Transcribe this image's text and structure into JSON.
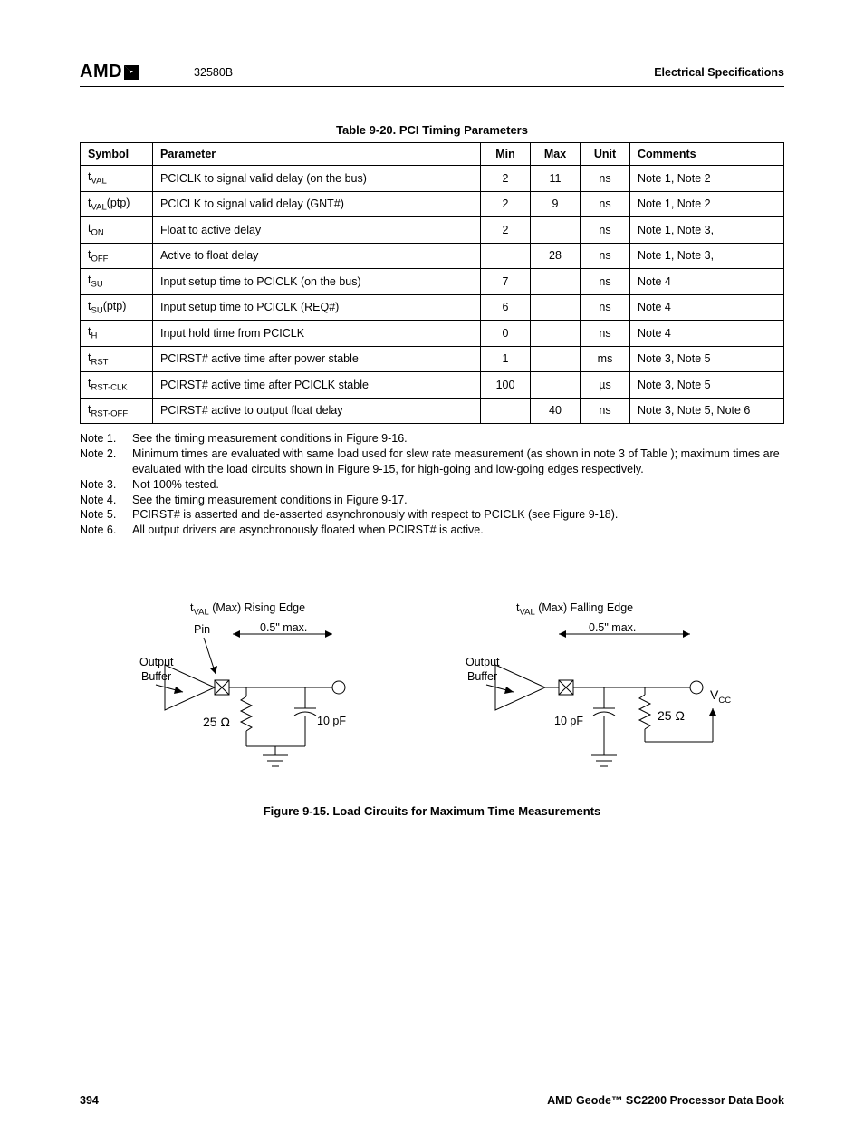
{
  "header": {
    "logo_text": "AMD",
    "doc_code": "32580B",
    "section": "Electrical Specifications"
  },
  "table": {
    "caption": "Table 9-20.  PCI Timing Parameters",
    "headers": [
      "Symbol",
      "Parameter",
      "Min",
      "Max",
      "Unit",
      "Comments"
    ],
    "rows": [
      {
        "sym_base": "t",
        "sym_sub": "VAL",
        "sym_suffix": "",
        "param": "PCICLK to signal valid delay (on the bus)",
        "min": "2",
        "max": "11",
        "unit": "ns",
        "comments": "Note 1, Note 2"
      },
      {
        "sym_base": "t",
        "sym_sub": "VAL",
        "sym_suffix": "(ptp)",
        "param": "PCICLK to signal valid delay (GNT#)",
        "min": "2",
        "max": "9",
        "unit": "ns",
        "comments": "Note 1, Note 2"
      },
      {
        "sym_base": "t",
        "sym_sub": "ON",
        "sym_suffix": "",
        "param": "Float to active delay",
        "min": "2",
        "max": "",
        "unit": "ns",
        "comments": "Note 1, Note 3,"
      },
      {
        "sym_base": "t",
        "sym_sub": "OFF",
        "sym_suffix": "",
        "param": "Active to float delay",
        "min": "",
        "max": "28",
        "unit": "ns",
        "comments": "Note 1, Note 3,"
      },
      {
        "sym_base": "t",
        "sym_sub": "SU",
        "sym_suffix": "",
        "param": "Input setup time to PCICLK (on the bus)",
        "min": "7",
        "max": "",
        "unit": "ns",
        "comments": "Note 4"
      },
      {
        "sym_base": "t",
        "sym_sub": "SU",
        "sym_suffix": "(ptp)",
        "param": "Input setup time to PCICLK (REQ#)",
        "min": "6",
        "max": "",
        "unit": "ns",
        "comments": "Note 4"
      },
      {
        "sym_base": "t",
        "sym_sub": "H",
        "sym_suffix": "",
        "param": "Input hold time from PCICLK",
        "min": "0",
        "max": "",
        "unit": "ns",
        "comments": "Note 4"
      },
      {
        "sym_base": "t",
        "sym_sub": "RST",
        "sym_suffix": "",
        "param": "PCIRST# active time after power stable",
        "min": "1",
        "max": "",
        "unit": "ms",
        "comments": "Note 3, Note 5"
      },
      {
        "sym_base": "t",
        "sym_sub": "RST-CLK",
        "sym_suffix": "",
        "param": "PCIRST# active time after PCICLK stable",
        "min": "100",
        "max": "",
        "unit": "µs",
        "comments": "Note 3, Note 5"
      },
      {
        "sym_base": "t",
        "sym_sub": "RST-OFF",
        "sym_suffix": "",
        "param": "PCIRST# active to output float delay",
        "min": "",
        "max": "40",
        "unit": "ns",
        "comments": "Note 3, Note 5, Note 6"
      }
    ]
  },
  "notes": [
    {
      "label": "Note 1.",
      "text": "See the timing measurement conditions in Figure 9-16."
    },
    {
      "label": "Note 2.",
      "text": "Minimum times are evaluated with same load used for slew rate measurement (as shown in note 3 of Table ); maximum times are evaluated with the load circuits shown in Figure 9-15, for high-going and low-going edges respectively."
    },
    {
      "label": "Note 3.",
      "text": "Not 100% tested."
    },
    {
      "label": "Note 4.",
      "text": "See the timing measurement conditions in Figure 9-17."
    },
    {
      "label": "Note 5.",
      "text": "PCIRST# is asserted and de-asserted asynchronously with respect to PCICLK (see Figure 9-18)."
    },
    {
      "label": "Note 6.",
      "text": "All output drivers are asynchronously floated when PCIRST# is active."
    }
  ],
  "figure": {
    "left": {
      "title_prefix": "t",
      "title_sub": "VAL",
      "title_suffix": " (Max) Rising Edge",
      "pin": "Pin",
      "dist": "0.5\" max.",
      "outbuf1": "Output",
      "outbuf2": "Buffer",
      "res": "25 Ω",
      "cap": "10 pF"
    },
    "right": {
      "title_prefix": "t",
      "title_sub": "VAL",
      "title_suffix": " (Max) Falling Edge",
      "dist": "0.5\" max.",
      "outbuf1": "Output",
      "outbuf2": "Buffer",
      "res": "25 Ω",
      "cap": "10 pF",
      "vcc": "V",
      "vcc_sub": "CC"
    },
    "caption": "Figure 9-15.  Load Circuits for Maximum Time Measurements"
  },
  "footer": {
    "page": "394",
    "book": "AMD Geode™ SC2200  Processor Data Book"
  },
  "chart_data": {
    "type": "table",
    "title": "Table 9-20. PCI Timing Parameters",
    "columns": [
      "Symbol",
      "Parameter",
      "Min",
      "Max",
      "Unit",
      "Comments"
    ],
    "rows": [
      [
        "t_VAL",
        "PCICLK to signal valid delay (on the bus)",
        2,
        11,
        "ns",
        "Note 1, Note 2"
      ],
      [
        "t_VAL(ptp)",
        "PCICLK to signal valid delay (GNT#)",
        2,
        9,
        "ns",
        "Note 1, Note 2"
      ],
      [
        "t_ON",
        "Float to active delay",
        2,
        null,
        "ns",
        "Note 1, Note 3"
      ],
      [
        "t_OFF",
        "Active to float delay",
        null,
        28,
        "ns",
        "Note 1, Note 3"
      ],
      [
        "t_SU",
        "Input setup time to PCICLK (on the bus)",
        7,
        null,
        "ns",
        "Note 4"
      ],
      [
        "t_SU(ptp)",
        "Input setup time to PCICLK (REQ#)",
        6,
        null,
        "ns",
        "Note 4"
      ],
      [
        "t_H",
        "Input hold time from PCICLK",
        0,
        null,
        "ns",
        "Note 4"
      ],
      [
        "t_RST",
        "PCIRST# active time after power stable",
        1,
        null,
        "ms",
        "Note 3, Note 5"
      ],
      [
        "t_RST-CLK",
        "PCIRST# active time after PCICLK stable",
        100,
        null,
        "µs",
        "Note 3, Note 5"
      ],
      [
        "t_RST-OFF",
        "PCIRST# active to output float delay",
        null,
        40,
        "ns",
        "Note 3, Note 5, Note 6"
      ]
    ]
  }
}
